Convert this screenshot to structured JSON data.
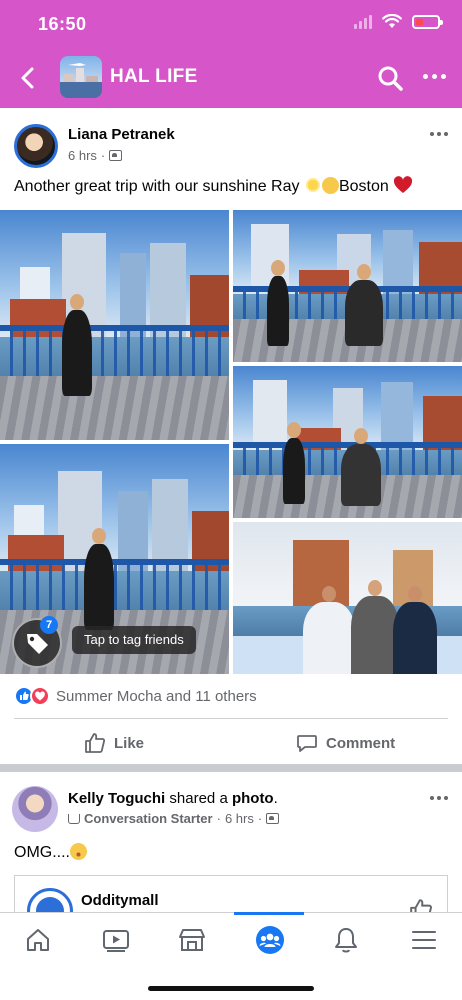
{
  "status_bar": {
    "time": "16:50"
  },
  "app_bar": {
    "title": "HAL LIFE"
  },
  "post1": {
    "author": "Liana Petranek",
    "time": "6 hrs",
    "separator": "·",
    "text_main": "Another great trip with our sunshine Ray",
    "text_place": "Boston",
    "tag_count": "7",
    "tag_tooltip": "Tap to tag friends",
    "reactions": "Summer Mocha and 11 others",
    "like_label": "Like",
    "comment_label": "Comment"
  },
  "post2": {
    "author": "Kelly Toguchi",
    "shared_text": "shared a",
    "shared_object": "photo",
    "period": ".",
    "badge": "Conversation Starter",
    "separator": "·",
    "time": "6 hrs",
    "text": "OMG....",
    "shared_page_name": "Odditymall"
  },
  "bottom_nav": {
    "items": [
      "home-icon",
      "video-icon",
      "marketplace-icon",
      "groups-icon",
      "notifications-icon",
      "menu-icon"
    ],
    "active": "groups-icon"
  },
  "colors": {
    "header": "#d656c9",
    "accent": "#1877f2",
    "love": "#f33e58",
    "muted_text": "#65676b",
    "battery": "#ff4a4a"
  }
}
